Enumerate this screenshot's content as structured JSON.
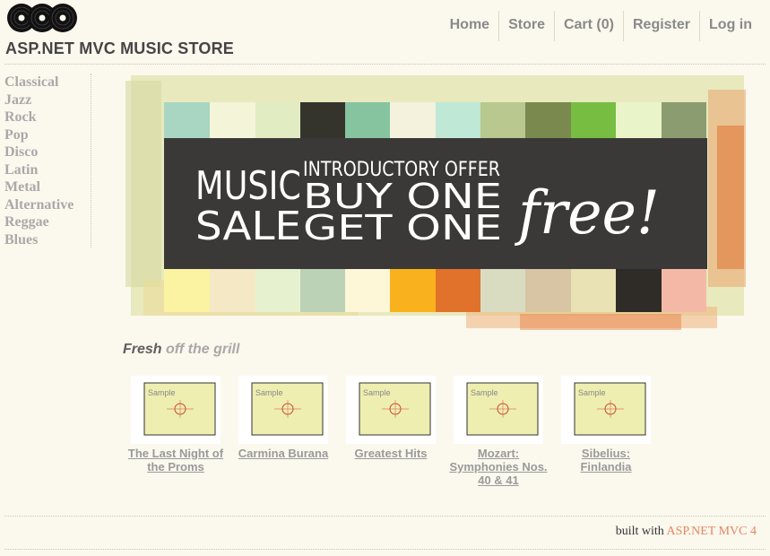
{
  "header": {
    "site_title": "ASP.NET MVC MUSIC STORE",
    "logo_icon": "vinyl-records-icon",
    "nav": [
      "Home",
      "Store",
      "Cart (0)",
      "Register",
      "Log in"
    ]
  },
  "genres": [
    "Classical",
    "Jazz",
    "Rock",
    "Pop",
    "Disco",
    "Latin",
    "Metal",
    "Alternative",
    "Reggae",
    "Blues"
  ],
  "banner": {
    "line_music": "MUSIC",
    "line_sale": "SALE",
    "intro": "INTRODUCTORY OFFER",
    "buy_one": "BUY ONE",
    "get_one": "GET ONE",
    "free": "free!"
  },
  "fresh": {
    "word1": "Fresh",
    "word2": "off the grill"
  },
  "albums": [
    {
      "title": "The Last Night of the Proms",
      "thumb_text": "Sample"
    },
    {
      "title": "Carmina Burana",
      "thumb_text": "Sample"
    },
    {
      "title": "Greatest Hits",
      "thumb_text": "Sample"
    },
    {
      "title": "Mozart: Symphonies Nos. 40 & 41",
      "thumb_text": "Sample"
    },
    {
      "title": "Sibelius: Finlandia",
      "thumb_text": "Sample"
    }
  ],
  "footer": {
    "built_with": "built with",
    "brand": "ASP.NET MVC 4"
  },
  "colors": {
    "background": "#fbf8ee",
    "banner_dark": "#3b3937",
    "accent_orange": "#e7865f",
    "thumb_fill": "#eeeeb0"
  }
}
